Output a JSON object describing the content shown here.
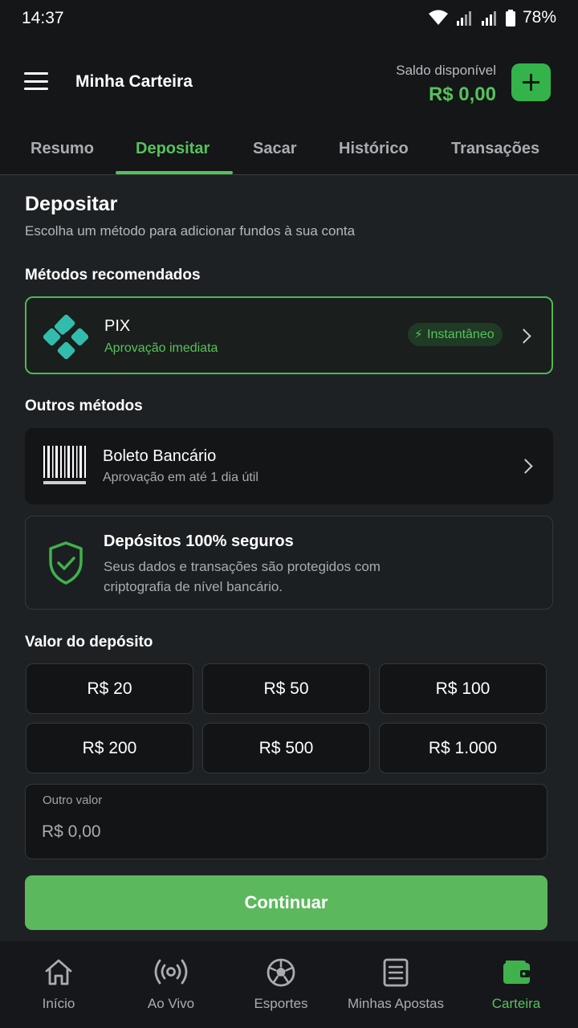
{
  "status_bar": {
    "time": "14:37",
    "battery": "78%"
  },
  "header": {
    "title": "Minha Carteira",
    "balance_label": "Saldo disponível",
    "balance_value": "R$ 0,00"
  },
  "tabs": [
    {
      "label": "Resumo",
      "active": false
    },
    {
      "label": "Depositar",
      "active": true
    },
    {
      "label": "Sacar",
      "active": false
    },
    {
      "label": "Histórico",
      "active": false
    },
    {
      "label": "Transações",
      "active": false
    }
  ],
  "deposit": {
    "title": "Depositar",
    "subtitle": "Escolha um método para adicionar fundos à sua conta",
    "recommended_label": "Métodos recomendados",
    "pix": {
      "title": "PIX",
      "subtitle": "Aprovação imediata",
      "badge": "Instantâneo"
    },
    "other_label": "Outros métodos",
    "boleto": {
      "title": "Boleto Bancário",
      "subtitle": "Aprovação em até 1 dia útil"
    },
    "secure": {
      "title": "Depósitos 100% seguros",
      "text_line1": "Seus dados e transações são protegidos com",
      "text_line2": "criptografia de nível bancário."
    },
    "amount_label": "Valor do depósito",
    "amounts": [
      "R$ 20",
      "R$ 50",
      "R$ 100",
      "R$ 200",
      "R$ 500",
      "R$ 1.000"
    ],
    "other_value_label": "Outro valor",
    "other_value_placeholder": "R$ 0,00",
    "continue_label": "Continuar"
  },
  "bottom_nav": [
    {
      "label": "Início",
      "icon": "home-icon",
      "active": false
    },
    {
      "label": "Ao Vivo",
      "icon": "live-broadcast-icon",
      "active": false
    },
    {
      "label": "Esportes",
      "icon": "soccer-ball-icon",
      "active": false
    },
    {
      "label": "Minhas Apostas",
      "icon": "bet-slip-icon",
      "active": false
    },
    {
      "label": "Carteira",
      "icon": "wallet-icon",
      "active": true
    }
  ],
  "colors": {
    "accent": "#56c25a",
    "button": "#5cb85c",
    "pix": "#32bcad",
    "background": "#1e2124"
  }
}
